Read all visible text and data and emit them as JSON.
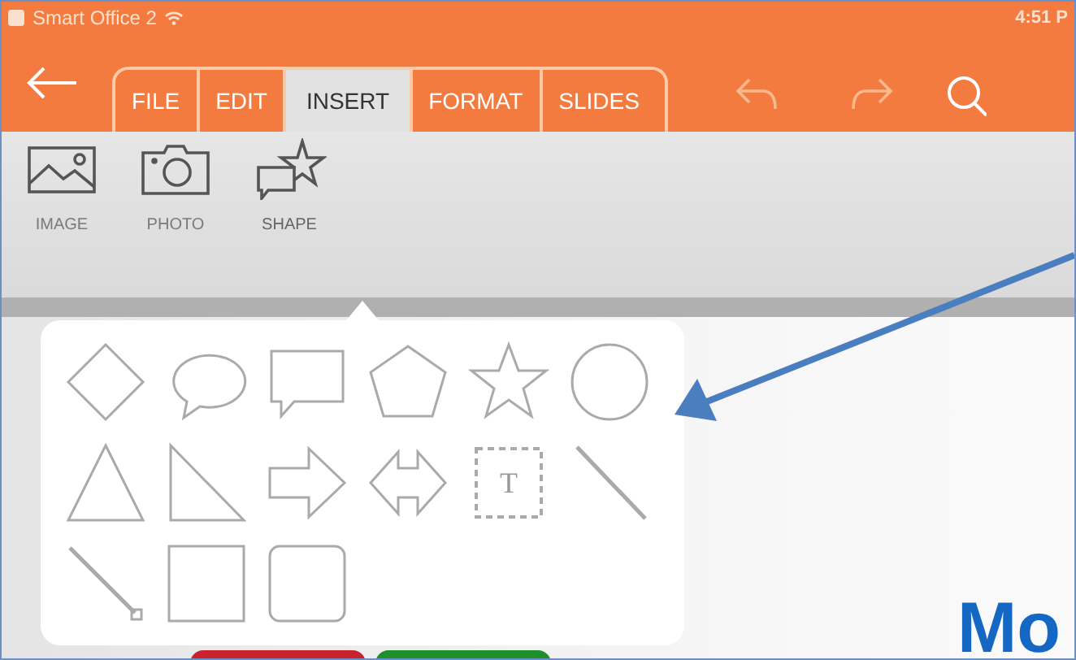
{
  "status_bar": {
    "app": "Smart Office 2",
    "time": "4:51 P"
  },
  "tabs": [
    {
      "label": "FILE",
      "selected": false
    },
    {
      "label": "EDIT",
      "selected": false
    },
    {
      "label": "INSERT",
      "selected": true
    },
    {
      "label": "FORMAT",
      "selected": false
    },
    {
      "label": "SLIDES",
      "selected": false
    }
  ],
  "ribbon": [
    {
      "label": "IMAGE",
      "kind": "image",
      "selected": false
    },
    {
      "label": "PHOTO",
      "kind": "photo",
      "selected": false
    },
    {
      "label": "SHAPE",
      "kind": "shape",
      "selected": true
    }
  ],
  "shapes": [
    {
      "kind": "diamond"
    },
    {
      "kind": "oval_callout"
    },
    {
      "kind": "rect_callout"
    },
    {
      "kind": "pentagon"
    },
    {
      "kind": "star"
    },
    {
      "kind": "circle"
    },
    {
      "kind": "triangle"
    },
    {
      "kind": "right_triangle"
    },
    {
      "kind": "arrow"
    },
    {
      "kind": "double_arrow"
    },
    {
      "kind": "text_box",
      "label": "T"
    },
    {
      "kind": "line"
    },
    {
      "kind": "line_arrow"
    },
    {
      "kind": "square"
    },
    {
      "kind": "rounded_square"
    }
  ],
  "slide": {
    "title": "Mo"
  }
}
